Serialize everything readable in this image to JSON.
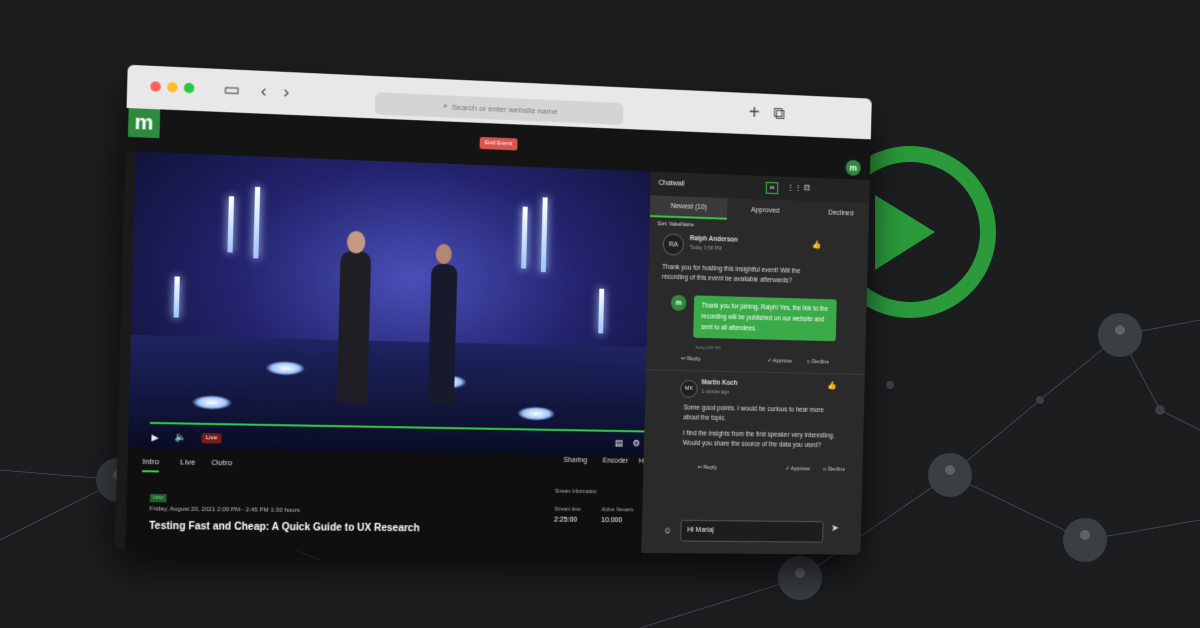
{
  "browser": {
    "search_placeholder": "Search or enter website name"
  },
  "app": {
    "logo_text": "m",
    "end_event_label": "End Event",
    "user_avatar_text": "m"
  },
  "video": {
    "live_label": "Live",
    "progress": 0.98
  },
  "tabs": [
    "Intro",
    "Live",
    "Outro"
  ],
  "right_links": [
    "Sharing",
    "Encoder",
    "Help"
  ],
  "event": {
    "badge": "Intro",
    "date": "Friday, August 20, 2021 2:00 PM - 2:45 PM 1:30 hours",
    "title": "Testing Fast and Cheap: A Quick Guide to UX Research"
  },
  "stream": {
    "heading": "Stream Information",
    "time_label": "Stream time",
    "time_value": "2:25:00",
    "viewers_label": "Active Viewers",
    "viewers_value": "10.000"
  },
  "chat": {
    "title": "Chatwall",
    "header_btn": "ss",
    "tabs": [
      "Newest (10)",
      "Approved",
      "Declined"
    ],
    "sort_label": "Sort: ValueName",
    "messages": [
      {
        "initials": "RA",
        "name": "Ralph Anderson",
        "time": "Today 3:56 PM",
        "text": "Thank you for hosting this insightful event! Will the recording of this event be available afterwards?"
      },
      {
        "initials": "MK",
        "name": "Martin Koch",
        "time": "1 minute ago",
        "text": "Some good points. I would be curious to hear more about the topic.",
        "text2": "I find the insights from the first speaker very interesting. Would you share the source of the data you used?"
      }
    ],
    "reply": {
      "text": "Thank you for joining, Ralph! Yes, the link to the recording will be published on our website and sent to all attendees.",
      "time": "Today 3:58 PM"
    },
    "actions": {
      "reply": "Reply",
      "approve": "Approve",
      "decline": "Decline"
    },
    "input_value": "Hi Maria|"
  },
  "colors": {
    "accent": "#2ecc40",
    "brand": "#2e8b3e",
    "end_event": "#d9534f"
  }
}
